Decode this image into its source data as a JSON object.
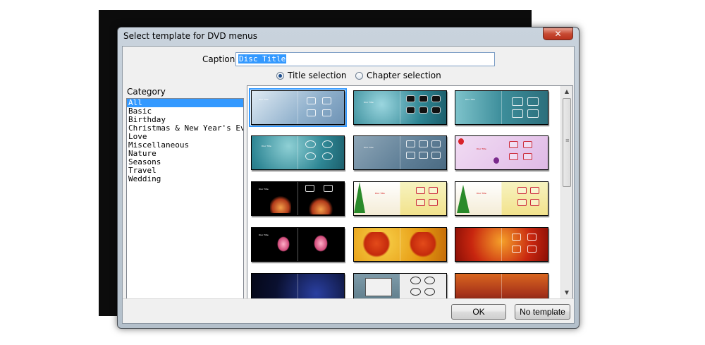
{
  "dialog": {
    "title": "Select template for DVD menus",
    "close_glyph": "✕",
    "caption_label": "Caption:",
    "caption_value": "Disc Title",
    "radio_title": "Title selection",
    "radio_chapter": "Chapter selection",
    "category_label": "Category",
    "categories": [
      "All",
      "Basic",
      "Birthday",
      "Christmas & New Year's Ev",
      "Love",
      "Miscellaneous",
      "Nature",
      "Seasons",
      "Travel",
      "Wedding"
    ],
    "selected_category": "All",
    "ok_label": "OK",
    "no_template_label": "No template"
  },
  "thumbnails": [
    {
      "id": "basic-light-blue",
      "selected": true,
      "title": "Disc Title"
    },
    {
      "id": "teal-dark-boxes",
      "selected": false,
      "title": "Disc Title"
    },
    {
      "id": "teal-frames",
      "selected": false,
      "title": "Disc Title"
    },
    {
      "id": "teal-ovals",
      "selected": false,
      "title": "Disc Title"
    },
    {
      "id": "grey-blue-boxes",
      "selected": false,
      "title": "Disc Title"
    },
    {
      "id": "birthday-balloons",
      "selected": false,
      "title": "Disc Title"
    },
    {
      "id": "birthday-cake",
      "selected": false,
      "title": "Disc Title"
    },
    {
      "id": "christmas-tree-1",
      "selected": false,
      "title": "Disc Title"
    },
    {
      "id": "christmas-tree-2",
      "selected": false,
      "title": "Disc Title"
    },
    {
      "id": "pink-tree-black",
      "selected": false,
      "title": "Disc Title"
    },
    {
      "id": "golden-heart",
      "selected": false,
      "title": ""
    },
    {
      "id": "red-hearts",
      "selected": false,
      "title": ""
    },
    {
      "id": "dark-blue-swirl",
      "selected": false,
      "title": ""
    },
    {
      "id": "grey-frames",
      "selected": false,
      "title": ""
    },
    {
      "id": "sunset-clouds",
      "selected": false,
      "title": ""
    }
  ],
  "icons": {
    "scroll_up": "▲",
    "scroll_down": "▼",
    "grip": "≡"
  }
}
